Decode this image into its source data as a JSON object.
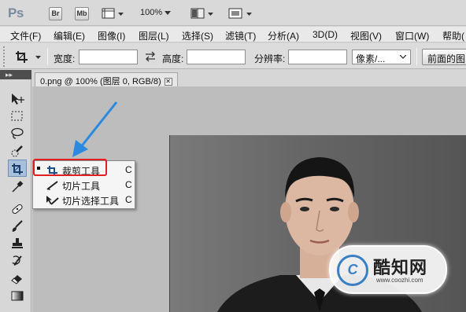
{
  "app": {
    "logo": "Ps",
    "bridge_chip": "Br",
    "minibridge_chip": "Mb",
    "zoom": "100%"
  },
  "menubar": {
    "items": [
      "文件(F)",
      "编辑(E)",
      "图像(I)",
      "图层(L)",
      "选择(S)",
      "滤镜(T)",
      "分析(A)",
      "3D(D)",
      "视图(V)",
      "窗口(W)",
      "帮助("
    ]
  },
  "options": {
    "width_label": "宽度:",
    "width_value": "",
    "height_label": "高度:",
    "height_value": "",
    "resolution_label": "分辨率:",
    "resolution_value": "",
    "unit_select": "像素/...",
    "front_image_button": "前面的图"
  },
  "toolbar": {
    "grip": "▸▸",
    "tools": [
      "move",
      "marquee",
      "lasso",
      "quick-select",
      "crop",
      "eyedropper",
      "healing",
      "brush",
      "clone-stamp",
      "history-brush",
      "eraser",
      "gradient"
    ]
  },
  "document": {
    "tab_title": "0.png @ 100% (图层 0, RGB/8)",
    "close": "✕"
  },
  "flyout": {
    "items": [
      {
        "label": "裁剪工具",
        "key": "C"
      },
      {
        "label": "切片工具",
        "key": "C"
      },
      {
        "label": "切片选择工具",
        "key": "C"
      }
    ]
  },
  "watermark": {
    "name": "酷知网",
    "url": "www.coozhi.com"
  },
  "colors": {
    "arrow": "#2b8ae0",
    "highlight": "#e02020",
    "active_tool": "#a9c0dc"
  }
}
